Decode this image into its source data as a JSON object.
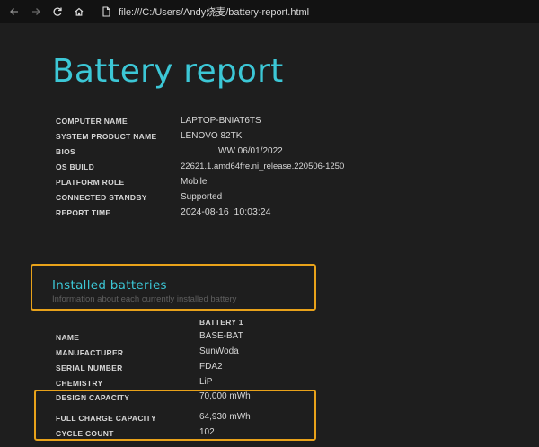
{
  "browser": {
    "url": "file:///C:/Users/Andy烧麦/battery-report.html"
  },
  "report": {
    "title": "Battery report",
    "system_info": [
      {
        "label": "COMPUTER NAME",
        "value": "LAPTOP-BNIAT6TS"
      },
      {
        "label": "SYSTEM PRODUCT NAME",
        "value": "LENOVO 82TK"
      },
      {
        "label": "BIOS",
        "value": "WW 06/01/2022"
      },
      {
        "label": "OS BUILD",
        "value": "22621.1.amd64fre.ni_release.220506-1250"
      },
      {
        "label": "PLATFORM ROLE",
        "value": "Mobile"
      },
      {
        "label": "CONNECTED STANDBY",
        "value": "Supported"
      },
      {
        "label": "REPORT TIME",
        "value": "2024-08-16  10:03:24"
      }
    ]
  },
  "installed_batteries": {
    "title": "Installed batteries",
    "subtitle": "Information about each currently installed battery",
    "column_header": "BATTERY 1",
    "rows": [
      {
        "label": "NAME",
        "value": "BASE-BAT"
      },
      {
        "label": "MANUFACTURER",
        "value": "SunWoda"
      },
      {
        "label": "SERIAL NUMBER",
        "value": "FDA2"
      },
      {
        "label": "CHEMISTRY",
        "value": "LiP"
      },
      {
        "label": "DESIGN CAPACITY",
        "value": "70,000 mWh"
      },
      {
        "label": "FULL CHARGE CAPACITY",
        "value": "64,930 mWh"
      },
      {
        "label": "CYCLE COUNT",
        "value": "102"
      }
    ]
  },
  "colors": {
    "accent": "#3cc7d6",
    "highlight": "#e8a21a",
    "background": "#1e1e1e"
  }
}
